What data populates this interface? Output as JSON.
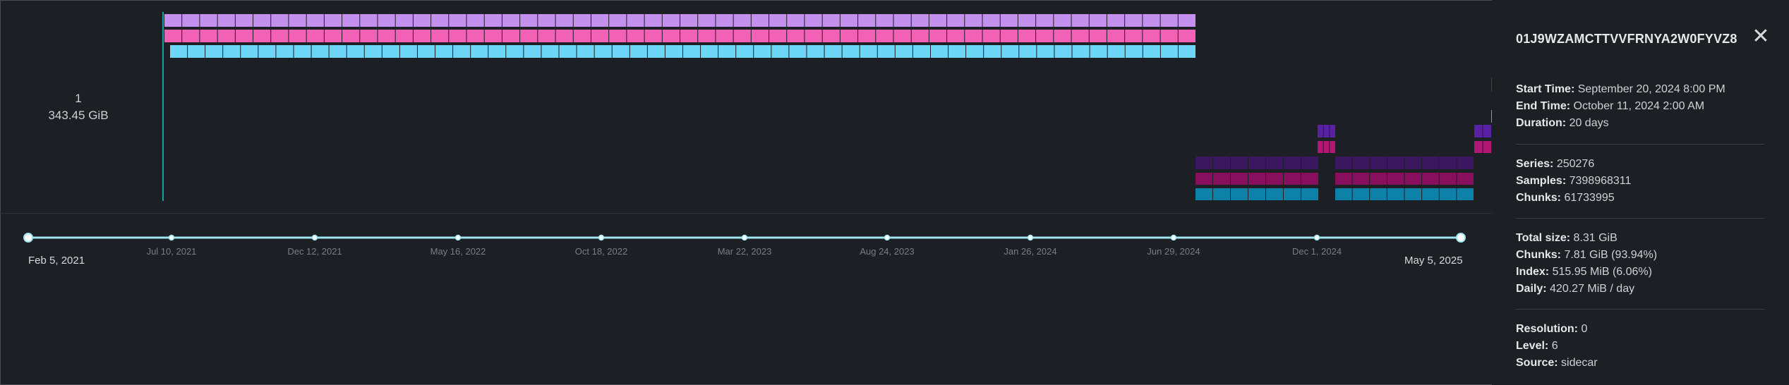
{
  "row_label": {
    "index": "1",
    "size": "343.45 GiB"
  },
  "colors": {
    "lavender": "#c490ee",
    "pink": "#f261b5",
    "cyan": "#6dd5f5",
    "dark_purple": "#3b1760",
    "dark_magenta": "#870f5e",
    "teal": "#0d81a8",
    "purple": "#5b21a5",
    "magenta": "#b31775",
    "track": "#9fe4ee"
  },
  "slider": {
    "start_label": "Feb 5, 2021",
    "end_label": "May 5, 2025",
    "ticks": [
      "Jul 10, 2021",
      "Dec 12, 2021",
      "May 16, 2022",
      "Oct 18, 2022",
      "Mar 22, 2023",
      "Aug 24, 2023",
      "Jan 26, 2024",
      "Jun 29, 2024",
      "Dec 1, 2024"
    ]
  },
  "details": {
    "block_id": "01J9WZAMCTTVVFRNYA2W0FYVZ8",
    "close_icon": "close-icon",
    "time": [
      {
        "label": "Start Time:",
        "value": "September 20, 2024 8:00 PM"
      },
      {
        "label": "End Time:",
        "value": "October 11, 2024 2:00 AM"
      },
      {
        "label": "Duration:",
        "value": "20 days"
      }
    ],
    "counts": [
      {
        "label": "Series:",
        "value": "250276"
      },
      {
        "label": "Samples:",
        "value": "7398968311"
      },
      {
        "label": "Chunks:",
        "value": "61733995"
      }
    ],
    "sizes": [
      {
        "label": "Total size:",
        "value": "8.31 GiB"
      },
      {
        "label": "Chunks:",
        "value": "7.81 GiB (93.94%)"
      },
      {
        "label": "Index:",
        "value": "515.95 MiB (6.06%)"
      },
      {
        "label": "Daily:",
        "value": "420.27 MiB / day"
      }
    ],
    "meta": [
      {
        "label": "Resolution:",
        "value": "0"
      },
      {
        "label": "Level:",
        "value": "6"
      },
      {
        "label": "Source:",
        "value": "sidecar"
      }
    ]
  }
}
